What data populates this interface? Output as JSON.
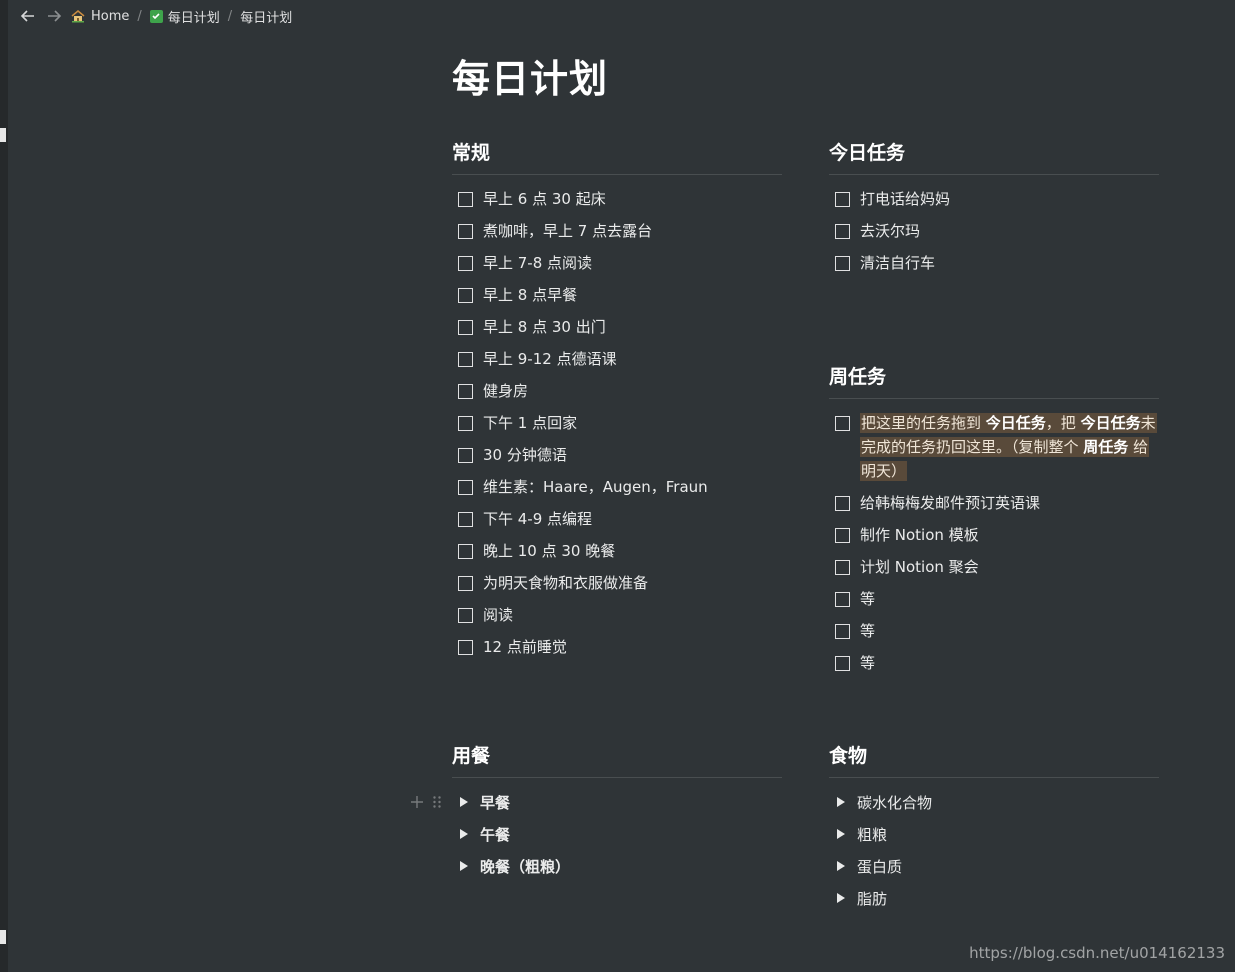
{
  "breadcrumb": {
    "home": "Home",
    "parent": "每日计划",
    "current": "每日计划"
  },
  "page": {
    "title": "每日计划"
  },
  "sections": {
    "routine": {
      "heading": "常规",
      "items": [
        "早上 6 点 30 起床",
        "煮咖啡，早上 7 点去露台",
        "早上 7-8 点阅读",
        "早上 8 点早餐",
        "早上 8 点 30 出门",
        "早上 9-12 点德语课",
        "健身房",
        "下午 1 点回家",
        "30 分钟德语",
        "维生素：Haare，Augen，Fraun",
        "下午 4-9 点编程",
        "晚上 10 点 30 晚餐",
        "为明天食物和衣服做准备",
        "阅读",
        "12 点前睡觉"
      ]
    },
    "today": {
      "heading": "今日任务",
      "items": [
        "打电话给妈妈",
        "去沃尔玛",
        "清洁自行车"
      ]
    },
    "weekly": {
      "heading": "周任务",
      "highlight": {
        "p1": "把这里的任务拖到 ",
        "b1": "今日任务",
        "p2": "，把 ",
        "b2": "今日任务",
        "p3": "未完成的任务扔回这里。（复制整个 ",
        "b3": "周任务",
        "p4": " 给明天）"
      },
      "items": [
        "给韩梅梅发邮件预订英语课",
        "制作 Notion 模板",
        "计划 Notion 聚会",
        "等",
        "等",
        "等"
      ]
    },
    "meals": {
      "heading": "用餐",
      "items": [
        "早餐",
        "午餐",
        "晚餐（粗粮）"
      ]
    },
    "food": {
      "heading": "食物",
      "items": [
        "碳水化合物",
        "粗粮",
        "蛋白质",
        "脂肪"
      ]
    }
  },
  "watermark": "https://blog.csdn.net/u014162133",
  "colors": {
    "background": "#2f3437",
    "highlight_bg": "#594a3a",
    "check_badge": "#3ea34b"
  }
}
